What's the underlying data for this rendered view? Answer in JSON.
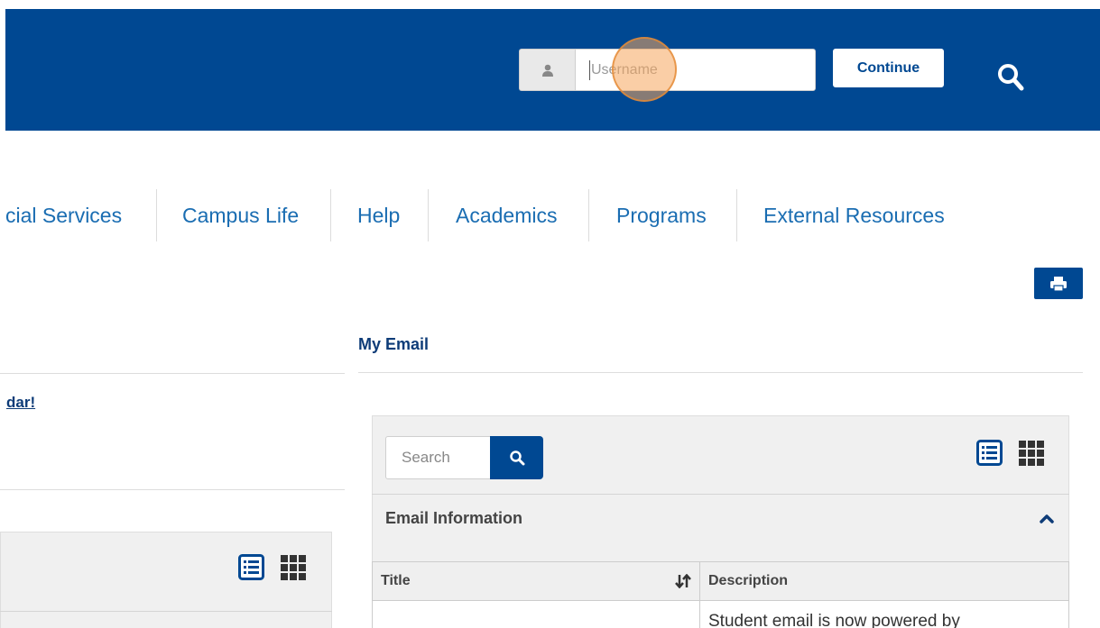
{
  "header": {
    "username_placeholder": "Username",
    "continue_label": "Continue"
  },
  "nav": {
    "items": [
      "cial Services",
      "Campus Life",
      "Help",
      "Academics",
      "Programs",
      "External Resources"
    ]
  },
  "left_column": {
    "link_text": "dar!"
  },
  "email_widget": {
    "heading": "My Email",
    "search_placeholder": "Search",
    "section_title": "Email Information",
    "table": {
      "columns": [
        "Title",
        "Description"
      ],
      "rows": [
        [
          "",
          "Student email is now powered by"
        ]
      ]
    }
  },
  "colors": {
    "brand_blue": "#004892",
    "link_blue": "#1a6db2",
    "heading_navy": "#0e3c78"
  },
  "icons": {
    "user": "user-icon",
    "search": "search-icon",
    "print": "print-icon",
    "list_view": "list-view-icon",
    "grid_view": "grid-view-icon",
    "sort": "sort-icon",
    "collapse": "chevron-up-icon"
  }
}
